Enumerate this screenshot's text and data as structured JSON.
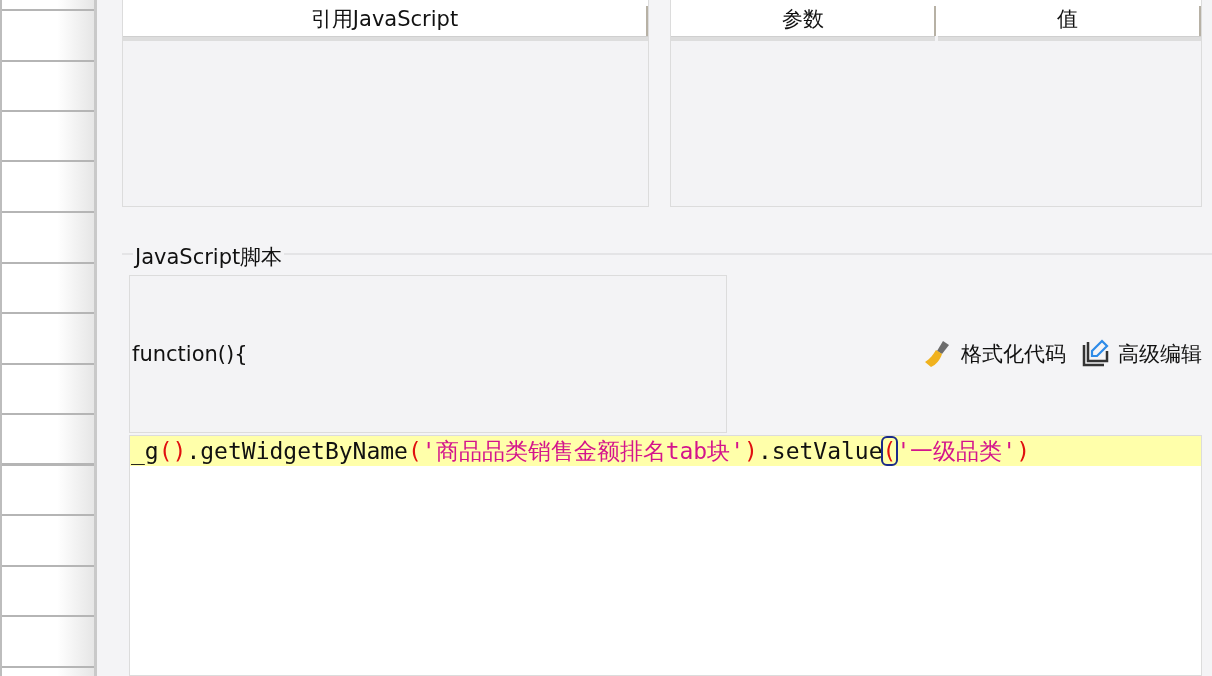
{
  "tables": [
    {
      "columns": [
        "引用JavaScript"
      ]
    },
    {
      "columns": [
        "参数",
        "值"
      ]
    }
  ],
  "script_section": {
    "legend": "JavaScript脚本",
    "header_code": "function(){",
    "buttons": [
      {
        "label": "格式化代码",
        "kind": "format"
      },
      {
        "label": "高级编辑",
        "kind": "edit"
      }
    ]
  },
  "editor": {
    "lines": [
      {
        "current": true,
        "tokens": [
          {
            "text": "_g",
            "kind": "plain",
            "matched": false
          },
          {
            "text": "()",
            "kind": "paren",
            "matched": false
          },
          {
            "text": ".getWidgetByName",
            "kind": "plain",
            "matched": false
          },
          {
            "text": "(",
            "kind": "paren",
            "matched": false
          },
          {
            "text": "'商品品类销售金额排名tab块'",
            "kind": "string",
            "matched": false
          },
          {
            "text": ")",
            "kind": "paren",
            "matched": false
          },
          {
            "text": ".setValue",
            "kind": "plain",
            "matched": false
          },
          {
            "text": "(",
            "kind": "paren",
            "matched": true
          },
          {
            "text": "'一级品类'",
            "kind": "string",
            "matched": false
          },
          {
            "text": ")",
            "kind": "paren",
            "matched": false
          }
        ]
      }
    ]
  }
}
